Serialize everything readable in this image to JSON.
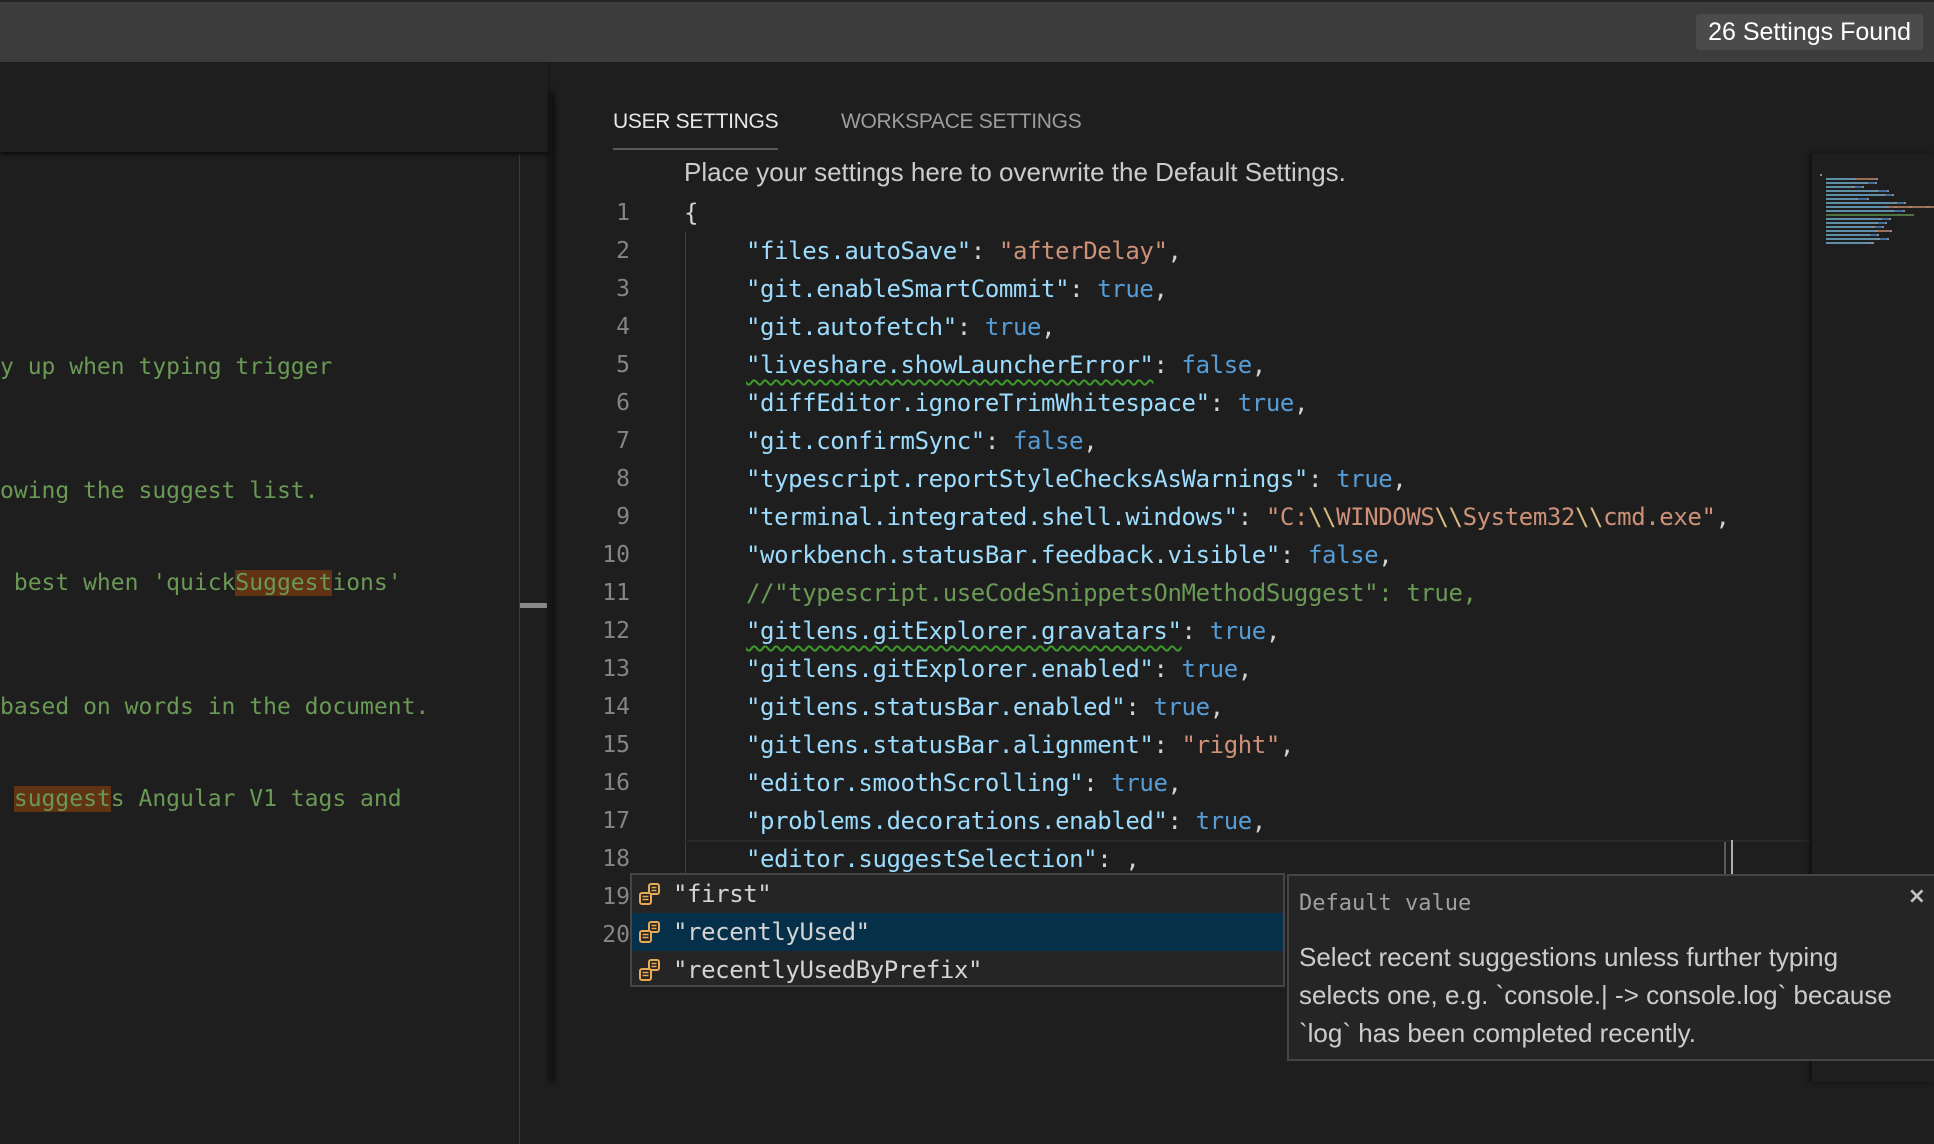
{
  "search": {
    "placeholder": "",
    "result_count": "26 Settings Found"
  },
  "default_settings_pane": {
    "visible_lines": [
      {
        "segments": [
          {
            "text": "y up when typing trigger"
          }
        ]
      },
      {
        "segments": [
          {
            "text": "owing the suggest list."
          }
        ]
      },
      {
        "segments": [
          {
            "text": " best when 'quick"
          },
          {
            "text": "Suggest",
            "match": true
          },
          {
            "text": "ions'"
          }
        ]
      },
      {
        "segments": [
          {
            "text": "based on words in the document."
          }
        ]
      },
      {
        "segments": [
          {
            "text": " "
          },
          {
            "text": "suggest",
            "match": true
          },
          {
            "text": "s Angular V1 tags and"
          }
        ]
      }
    ]
  },
  "tabs": [
    {
      "label": "USER SETTINGS",
      "active": true
    },
    {
      "label": "WORKSPACE SETTINGS",
      "active": false
    }
  ],
  "settings_hint": "Place your settings here to overwrite the Default Settings.",
  "editor": {
    "lines": [
      {
        "no": "1",
        "tokens": [
          {
            "t": "p",
            "v": "{"
          }
        ]
      },
      {
        "no": "2",
        "indent": true,
        "tokens": [
          {
            "t": "k",
            "v": "\"files.autoSave\""
          },
          {
            "t": "p",
            "v": ": "
          },
          {
            "t": "s",
            "v": "\"afterDelay\""
          },
          {
            "t": "p",
            "v": ","
          }
        ]
      },
      {
        "no": "3",
        "indent": true,
        "tokens": [
          {
            "t": "k",
            "v": "\"git.enableSmartCommit\""
          },
          {
            "t": "p",
            "v": ": "
          },
          {
            "t": "b",
            "v": "true"
          },
          {
            "t": "p",
            "v": ","
          }
        ]
      },
      {
        "no": "4",
        "indent": true,
        "tokens": [
          {
            "t": "k",
            "v": "\"git.autofetch\""
          },
          {
            "t": "p",
            "v": ": "
          },
          {
            "t": "b",
            "v": "true"
          },
          {
            "t": "p",
            "v": ","
          }
        ]
      },
      {
        "no": "5",
        "indent": true,
        "tokens": [
          {
            "t": "k",
            "v": "\"liveshare.showLauncherError\"",
            "warn": true
          },
          {
            "t": "p",
            "v": ": "
          },
          {
            "t": "b",
            "v": "false"
          },
          {
            "t": "p",
            "v": ","
          }
        ]
      },
      {
        "no": "6",
        "indent": true,
        "tokens": [
          {
            "t": "k",
            "v": "\"diffEditor.ignoreTrimWhitespace\""
          },
          {
            "t": "p",
            "v": ": "
          },
          {
            "t": "b",
            "v": "true"
          },
          {
            "t": "p",
            "v": ","
          }
        ]
      },
      {
        "no": "7",
        "indent": true,
        "tokens": [
          {
            "t": "k",
            "v": "\"git.confirmSync\""
          },
          {
            "t": "p",
            "v": ": "
          },
          {
            "t": "b",
            "v": "false"
          },
          {
            "t": "p",
            "v": ","
          }
        ]
      },
      {
        "no": "8",
        "indent": true,
        "tokens": [
          {
            "t": "k",
            "v": "\"typescript.reportStyleChecksAsWarnings\""
          },
          {
            "t": "p",
            "v": ": "
          },
          {
            "t": "b",
            "v": "true"
          },
          {
            "t": "p",
            "v": ","
          }
        ]
      },
      {
        "no": "9",
        "indent": true,
        "tokens": [
          {
            "t": "k",
            "v": "\"terminal.integrated.shell.windows\""
          },
          {
            "t": "p",
            "v": ": "
          },
          {
            "t": "s",
            "v": "\"C:"
          },
          {
            "t": "esc",
            "v": "\\\\"
          },
          {
            "t": "s",
            "v": "WINDOWS"
          },
          {
            "t": "esc",
            "v": "\\\\"
          },
          {
            "t": "s",
            "v": "System32"
          },
          {
            "t": "esc",
            "v": "\\\\"
          },
          {
            "t": "s",
            "v": "cmd.exe\""
          },
          {
            "t": "p",
            "v": ","
          }
        ]
      },
      {
        "no": "10",
        "indent": true,
        "tokens": [
          {
            "t": "k",
            "v": "\"workbench.statusBar.feedback.visible\""
          },
          {
            "t": "p",
            "v": ": "
          },
          {
            "t": "b",
            "v": "false"
          },
          {
            "t": "p",
            "v": ","
          }
        ]
      },
      {
        "no": "11",
        "indent": true,
        "tokens": [
          {
            "t": "c",
            "v": "//\"typescript.useCodeSnippetsOnMethodSuggest\": true,"
          }
        ]
      },
      {
        "no": "12",
        "indent": true,
        "tokens": [
          {
            "t": "k",
            "v": "\"gitlens.gitExplorer.gravatars\"",
            "warn": true
          },
          {
            "t": "p",
            "v": ": "
          },
          {
            "t": "b",
            "v": "true"
          },
          {
            "t": "p",
            "v": ","
          }
        ]
      },
      {
        "no": "13",
        "indent": true,
        "tokens": [
          {
            "t": "k",
            "v": "\"gitlens.gitExplorer.enabled\""
          },
          {
            "t": "p",
            "v": ": "
          },
          {
            "t": "b",
            "v": "true"
          },
          {
            "t": "p",
            "v": ","
          }
        ]
      },
      {
        "no": "14",
        "indent": true,
        "tokens": [
          {
            "t": "k",
            "v": "\"gitlens.statusBar.enabled\""
          },
          {
            "t": "p",
            "v": ": "
          },
          {
            "t": "b",
            "v": "true"
          },
          {
            "t": "p",
            "v": ","
          }
        ]
      },
      {
        "no": "15",
        "indent": true,
        "tokens": [
          {
            "t": "k",
            "v": "\"gitlens.statusBar.alignment\""
          },
          {
            "t": "p",
            "v": ": "
          },
          {
            "t": "s",
            "v": "\"right\""
          },
          {
            "t": "p",
            "v": ","
          }
        ]
      },
      {
        "no": "16",
        "indent": true,
        "tokens": [
          {
            "t": "k",
            "v": "\"editor.smoothScrolling\""
          },
          {
            "t": "p",
            "v": ": "
          },
          {
            "t": "b",
            "v": "true"
          },
          {
            "t": "p",
            "v": ","
          }
        ]
      },
      {
        "no": "17",
        "indent": true,
        "tokens": [
          {
            "t": "k",
            "v": "\"problems.decorations.enabled\""
          },
          {
            "t": "p",
            "v": ": "
          },
          {
            "t": "b",
            "v": "true"
          },
          {
            "t": "p",
            "v": ","
          }
        ]
      },
      {
        "no": "18",
        "indent": true,
        "current": true,
        "tokens": [
          {
            "t": "k",
            "v": "\"editor.suggestSelection\""
          },
          {
            "t": "p",
            "v": ": "
          },
          {
            "t": "p",
            "v": ","
          }
        ]
      },
      {
        "no": "19",
        "tokens": []
      },
      {
        "no": "20",
        "tokens": []
      }
    ]
  },
  "suggest": {
    "items": [
      {
        "label": "\"first\"",
        "icon": "enum-member-icon",
        "focused": false
      },
      {
        "label": "\"recentlyUsed\"",
        "icon": "enum-member-icon",
        "focused": true
      },
      {
        "label": "\"recentlyUsedByPrefix\"",
        "icon": "enum-member-icon",
        "focused": false
      }
    ],
    "details": {
      "title": "Default value",
      "close_icon": "×",
      "documentation": "Select recent suggestions unless further typing selects one, e.g. `console.| -> console.log` because `log` has been completed recently."
    }
  },
  "colors": {
    "key": "#9cdcfe",
    "string": "#ce9178",
    "keyword": "#569cd6",
    "comment": "#6a9955",
    "focus_row": "#062f4a",
    "icon": "#e8ab53"
  }
}
